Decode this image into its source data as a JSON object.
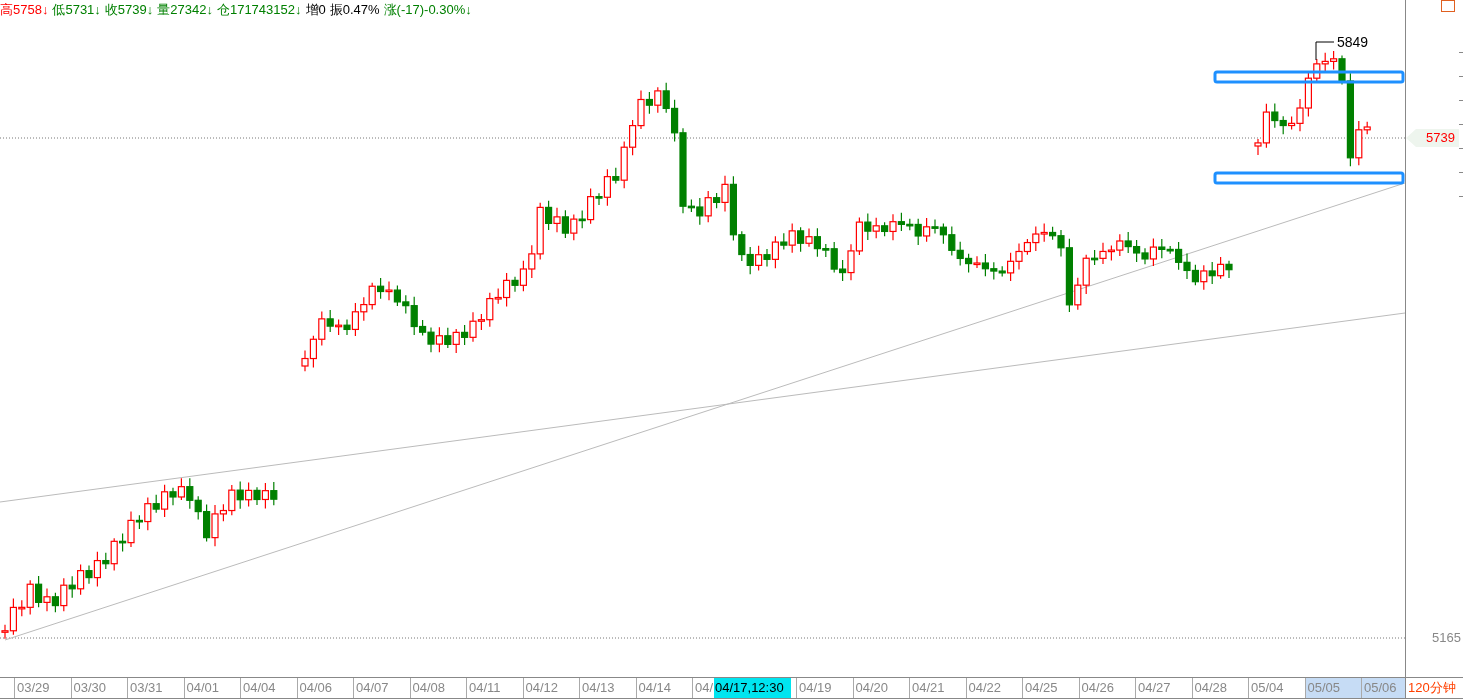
{
  "quote_bar": [
    {
      "label": "高",
      "value": "5758",
      "arrow": "↓",
      "color": "#ff0000"
    },
    {
      "label": "低",
      "value": "5731",
      "arrow": "↓",
      "color": "#008000"
    },
    {
      "label": "收",
      "value": "5739",
      "arrow": "↓",
      "color": "#008000"
    },
    {
      "label": "量",
      "value": "27342",
      "arrow": "↓",
      "color": "#008000"
    },
    {
      "label": "仓",
      "value": "171743152",
      "arrow": "↓",
      "color": "#008000"
    },
    {
      "label": "增",
      "value": "0",
      "color": "#000000"
    },
    {
      "label": "振",
      "value": "0.47%",
      "color": "#000000"
    },
    {
      "label": "涨",
      "value": "(-17)-0.30%",
      "arrow": "↓",
      "color": "#008000"
    }
  ],
  "chart": {
    "high_marker": "5849",
    "price_axis": [
      {
        "text": "5739",
        "kind": "current"
      },
      {
        "text": "5165",
        "kind": "low"
      }
    ]
  },
  "time_axis": {
    "labels": [
      {
        "text": "03/29",
        "kind": "date",
        "selected": false
      },
      {
        "text": "03/30",
        "kind": "date",
        "selected": false
      },
      {
        "text": "03/31",
        "kind": "date",
        "selected": false
      },
      {
        "text": "04/01",
        "kind": "date",
        "selected": false
      },
      {
        "text": "04/04",
        "kind": "date",
        "selected": false
      },
      {
        "text": "04/06",
        "kind": "date",
        "selected": false
      },
      {
        "text": "04/07",
        "kind": "date",
        "selected": false
      },
      {
        "text": "04/08",
        "kind": "date",
        "selected": false
      },
      {
        "text": "04/11",
        "kind": "date",
        "selected": false
      },
      {
        "text": "04/12",
        "kind": "date",
        "selected": false
      },
      {
        "text": "04/13",
        "kind": "date",
        "selected": false
      },
      {
        "text": "04/14",
        "kind": "date",
        "selected": false
      },
      {
        "text": "04/",
        "kind": "date",
        "selected": false
      },
      {
        "text": "04/17,12:30",
        "kind": "cursor"
      },
      {
        "text": "04/19",
        "kind": "date",
        "selected": false
      },
      {
        "text": "04/20",
        "kind": "date",
        "selected": false
      },
      {
        "text": "04/21",
        "kind": "date",
        "selected": false
      },
      {
        "text": "04/22",
        "kind": "date",
        "selected": false
      },
      {
        "text": "04/25",
        "kind": "date",
        "selected": false
      },
      {
        "text": "04/26",
        "kind": "date",
        "selected": false
      },
      {
        "text": "04/27",
        "kind": "date",
        "selected": false
      },
      {
        "text": "04/28",
        "kind": "date",
        "selected": false
      },
      {
        "text": "05/04",
        "kind": "date",
        "selected": false
      },
      {
        "text": "05/05",
        "kind": "date",
        "selected": true
      },
      {
        "text": "05/06",
        "kind": "date",
        "selected": true
      }
    ],
    "period": "120分钟"
  }
}
